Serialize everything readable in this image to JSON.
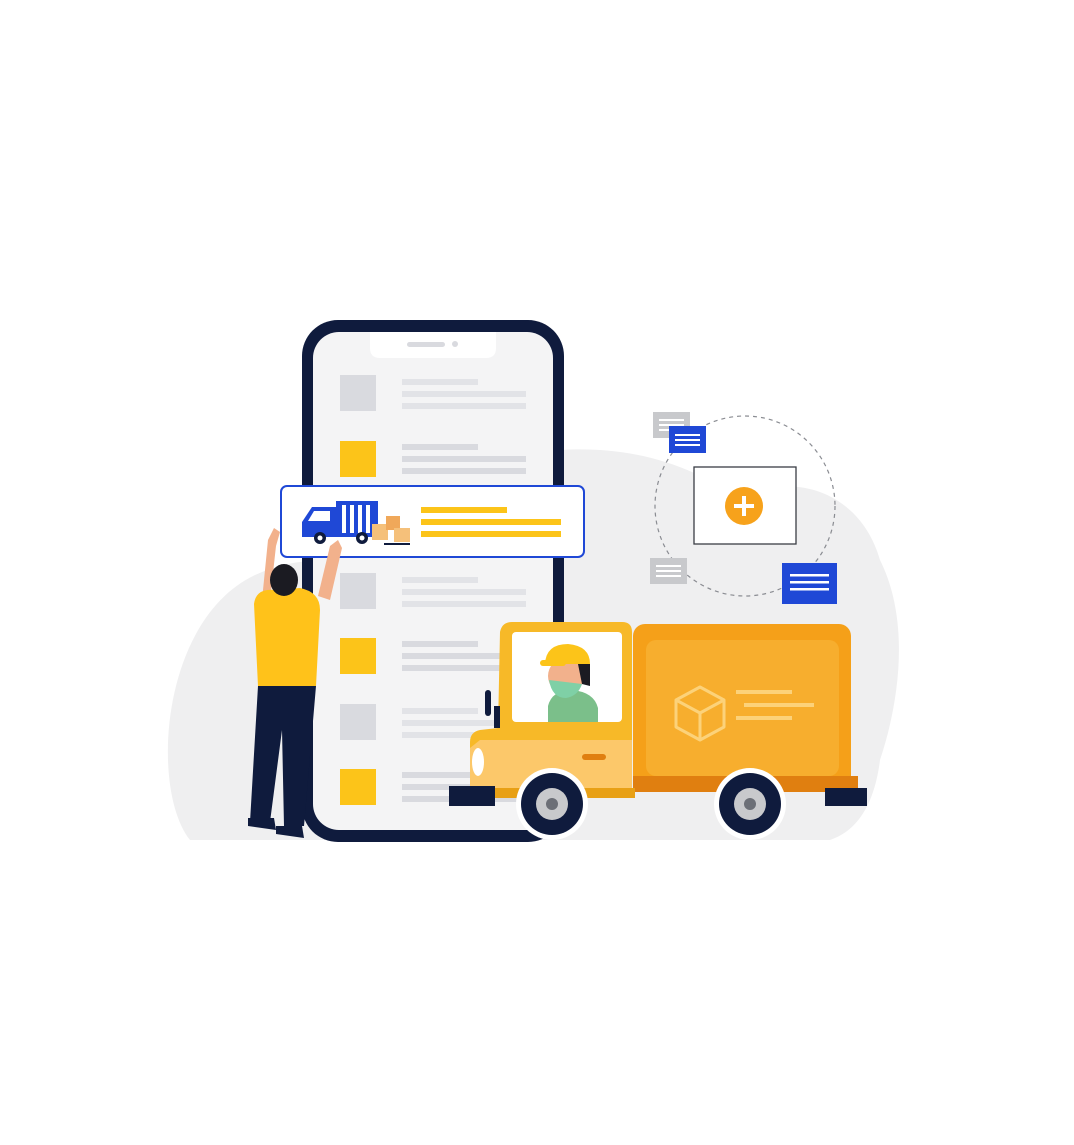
{
  "colors": {
    "background": "#ffffff",
    "cloud": "#efeff0",
    "phone_frame": "#0f1b3d",
    "phone_screen": "#f4f4f5",
    "placeholder_gray": "#d9dadf",
    "accent_yellow": "#fcc419",
    "accent_orange": "#f7a21b",
    "truck_cab": "#f7b928",
    "truck_cargo": "#f5a019",
    "truck_cargo_dark": "#e07f10",
    "blue_card": "#1f48d6",
    "gray_card": "#c8c9cc",
    "worker_shirt": "#ffc21a",
    "worker_pants": "#0f1b3d",
    "driver_shirt": "#7bbf8a",
    "mask": "#7fd0a6"
  },
  "icons": [
    "add-icon",
    "delivery-van-icon",
    "box-icon",
    "package-icon"
  ]
}
